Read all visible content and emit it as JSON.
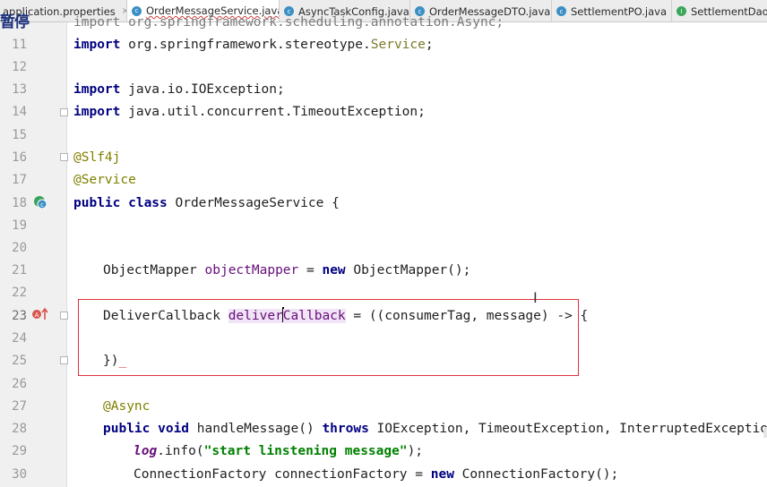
{
  "tabs": [
    {
      "label": "application.properties",
      "icon": "properties-file-icon",
      "active": false
    },
    {
      "label": "OrderMessageService.java",
      "icon": "class-icon",
      "active": true
    },
    {
      "label": "AsyncTaskConfig.java",
      "icon": "class-icon",
      "active": false
    },
    {
      "label": "OrderMessageDTO.java",
      "icon": "class-icon",
      "active": false
    },
    {
      "label": "SettlementPO.java",
      "icon": "class-icon",
      "active": false
    },
    {
      "label": "SettlementDao.java",
      "icon": "interface-icon",
      "active": false
    }
  ],
  "tab_close_glyph": "×",
  "tab_icon_letters": {
    "class": "c",
    "interface": "I"
  },
  "overlay_caption": "暂停",
  "line_numbers": [
    "11",
    "12",
    "13",
    "14",
    "15",
    "16",
    "17",
    "18",
    "19",
    "20",
    "21",
    "22",
    "23",
    "24",
    "25",
    "26",
    "27",
    "28",
    "29",
    "30"
  ],
  "partial_line_10": "import org.springframework.scheduling.annotation.Async;",
  "code": {
    "l11_kw": "import",
    "l11_rest": " org.springframework.stereotype.",
    "l11_cls": "Service",
    "l11_end": ";",
    "l13_kw": "import",
    "l13_rest": " java.io.IOException;",
    "l14_kw": "import",
    "l14_rest": " java.util.concurrent.TimeoutException;",
    "l16": "@Slf4j",
    "l17": "@Service",
    "l18_kw": "public class",
    "l18_rest": " OrderMessageService {",
    "l21_type": "ObjectMapper ",
    "l21_field": "objectMapper",
    "l21_eq": " = ",
    "l21_new": "new",
    "l21_rest": " ObjectMapper();",
    "l23_type": "DeliverCallback ",
    "l23_f1": "deliver",
    "l23_f2": "Callback",
    "l23_rest": " = ((consumerTag, message) -> {",
    "l25": "})",
    "l25_squiggle": "_",
    "l27": "@Async",
    "l28_kw": "public void",
    "l28_mid": " handleMessage() ",
    "l28_kw2": "throws",
    "l28_rest": " IOException, TimeoutException, InterruptedException {",
    "l29_log": "log",
    "l29_mid": ".info(",
    "l29_str": "\"start linstening message\"",
    "l29_end": ");",
    "l30_a": "ConnectionFactory connectionFactory = ",
    "l30_new": "new",
    "l30_rest": " ConnectionFactory();"
  },
  "cursor_glyph": "I",
  "colors": {
    "keyword": "#000080",
    "annotation": "#808000",
    "string": "#008000",
    "field": "#660e7a",
    "highlight": "#f1e4f6",
    "box": "#e0323e"
  }
}
